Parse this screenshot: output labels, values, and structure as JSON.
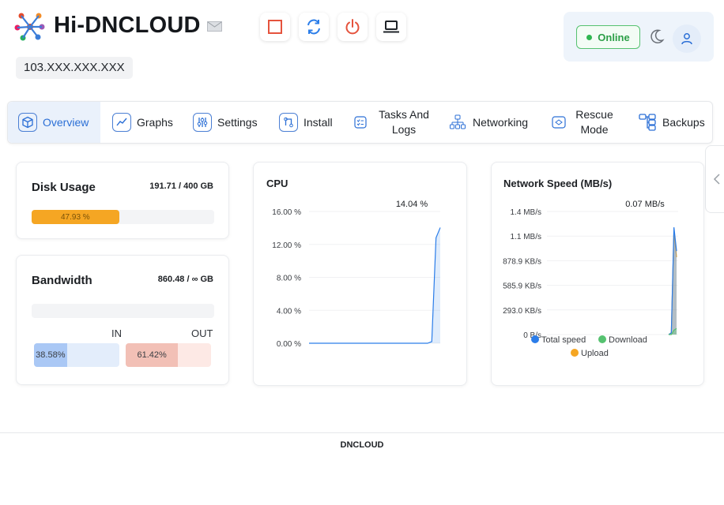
{
  "header": {
    "brand": "Hi-DNCLOUD",
    "ip": "103.XXX.XXX.XXX",
    "controls": [
      {
        "name": "stop-icon",
        "color": "#e5533d"
      },
      {
        "name": "restart-icon",
        "color": "#2b7de9"
      },
      {
        "name": "power-icon",
        "color": "#e5533d"
      },
      {
        "name": "console-icon",
        "color": "#1f2328"
      }
    ],
    "status": "Online",
    "status_color": "#2fb650"
  },
  "nav": {
    "items": [
      {
        "label": "Overview",
        "icon": "cube-icon",
        "active": true
      },
      {
        "label": "Graphs",
        "icon": "graph-icon"
      },
      {
        "label": "Settings",
        "icon": "sliders-icon"
      },
      {
        "label": "Install",
        "icon": "git-icon"
      },
      {
        "label": "Tasks And Logs",
        "icon": "checklist-icon"
      },
      {
        "label": "Networking",
        "icon": "network-icon"
      },
      {
        "label": "Rescue Mode",
        "icon": "rescue-icon"
      },
      {
        "label": "Backups",
        "icon": "backup-icon"
      }
    ]
  },
  "disk": {
    "title": "Disk Usage",
    "value": "191.71 / 400 GB",
    "percent_label": "47.93 %",
    "percent": 47.93,
    "color": "#f5a623"
  },
  "bandwidth": {
    "title": "Bandwidth",
    "value": "860.48 / ∞ GB",
    "in_label": "IN",
    "out_label": "OUT",
    "in_percent_label": "38.58%",
    "in_percent": 38.58,
    "out_percent_label": "61.42%",
    "out_percent": 61.42
  },
  "cpu": {
    "title": "CPU",
    "current": "14.04 %",
    "chart_data": {
      "type": "area",
      "y_ticks": [
        "16.00 %",
        "12.00 %",
        "8.00 %",
        "4.00 %",
        "0.00 %"
      ],
      "ylim": [
        0,
        16
      ],
      "values": [
        0,
        0,
        0,
        0,
        0,
        0,
        0,
        0,
        0,
        0,
        0,
        0,
        0,
        0,
        0,
        0,
        0,
        0,
        0,
        0,
        0,
        0,
        0,
        0,
        0,
        0,
        0,
        0,
        0,
        0.2,
        12.8,
        14.04
      ],
      "color": "#2b7de9"
    }
  },
  "network": {
    "title": "Network Speed (MB/s)",
    "current": "0.07 MB/s",
    "chart_data": {
      "type": "area",
      "y_ticks": [
        "1.4 MB/s",
        "1.1 MB/s",
        "878.9 KB/s",
        "585.9 KB/s",
        "293.0 KB/s",
        "0 B/s"
      ],
      "ylim": [
        0,
        1.4
      ],
      "series": [
        {
          "name": "Total speed",
          "color": "#2b7de9",
          "values": [
            0,
            0.02,
            1.22,
            0.95
          ]
        },
        {
          "name": "Download",
          "color": "#56c270",
          "values": [
            0,
            0.0,
            0.05,
            0.07
          ]
        },
        {
          "name": "Upload",
          "color": "#f5a623",
          "values": [
            0,
            0.02,
            1.18,
            0.88
          ]
        }
      ]
    }
  },
  "footer": {
    "text": "DNCLOUD"
  }
}
